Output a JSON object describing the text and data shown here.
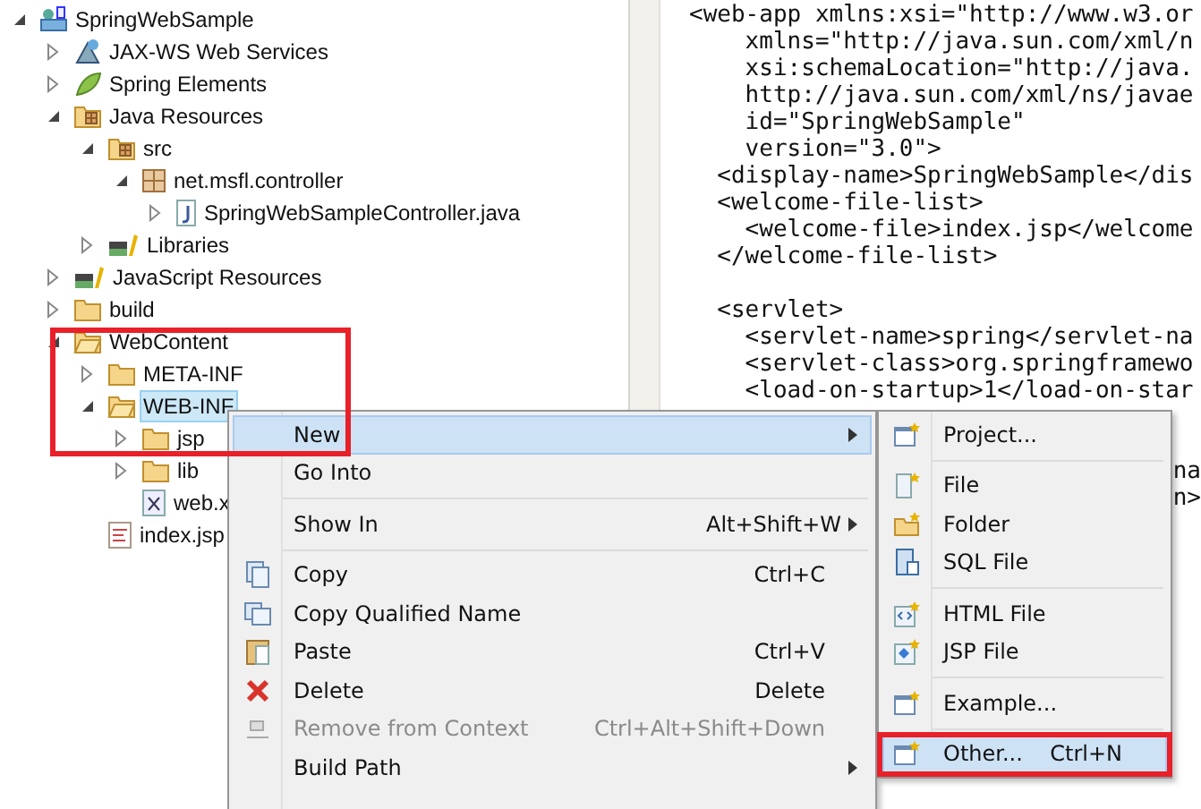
{
  "project_tree": [
    {
      "label": "SpringWebSample",
      "kind": "project",
      "expanded": true,
      "selected": false,
      "children": [
        {
          "label": "JAX-WS Web Services",
          "kind": "webservice",
          "expanded": false,
          "selected": false
        },
        {
          "label": "Spring Elements",
          "kind": "leaf",
          "expanded": false,
          "selected": false
        },
        {
          "label": "Java Resources",
          "kind": "javares",
          "expanded": true,
          "selected": false,
          "children": [
            {
              "label": "src",
              "kind": "srcfolder",
              "expanded": true,
              "selected": false,
              "children": [
                {
                  "label": "net.msfl.controller",
                  "kind": "package",
                  "expanded": true,
                  "selected": false,
                  "children": [
                    {
                      "label": "SpringWebSampleController.java",
                      "kind": "java",
                      "expanded": false,
                      "selected": false
                    }
                  ]
                }
              ]
            },
            {
              "label": "Libraries",
              "kind": "library",
              "expanded": false,
              "selected": false
            }
          ]
        },
        {
          "label": "JavaScript Resources",
          "kind": "library",
          "expanded": false,
          "selected": false
        },
        {
          "label": "build",
          "kind": "folder",
          "expanded": false,
          "selected": false
        },
        {
          "label": "WebContent",
          "kind": "folder",
          "expanded": true,
          "selected": false,
          "children": [
            {
              "label": "META-INF",
              "kind": "folder",
              "expanded": false,
              "selected": false
            },
            {
              "label": "WEB-INF",
              "kind": "folder",
              "expanded": true,
              "selected": true,
              "children": [
                {
                  "label": "jsp",
                  "kind": "folder",
                  "expanded": false,
                  "selected": false
                },
                {
                  "label": "lib",
                  "kind": "folder",
                  "expanded": false,
                  "selected": false
                },
                {
                  "label": "web.x",
                  "kind": "xml",
                  "selected": false
                }
              ]
            },
            {
              "label": "index.jsp",
              "kind": "jsp",
              "selected": false
            }
          ]
        }
      ]
    }
  ],
  "editor_lines": [
    {
      "kind": "code",
      "text": "<web-app xmlns:xsi=\"http://www.w3.or"
    },
    {
      "kind": "code",
      "text": "    xmlns=\"http://java.sun.com/xml/n"
    },
    {
      "kind": "code",
      "text": "    xsi:schemaLocation=\"http://java."
    },
    {
      "kind": "code",
      "text": "    http://java.sun.com/xml/ns/javae"
    },
    {
      "kind": "code",
      "text": "    id=\"SpringWebSample\""
    },
    {
      "kind": "code",
      "text": "    version=\"3.0\">"
    },
    {
      "kind": "code",
      "text": "  <display-name>SpringWebSample</dis"
    },
    {
      "kind": "code",
      "text": "  <welcome-file-list>"
    },
    {
      "kind": "code",
      "text": "    <welcome-file>index.jsp</welcome"
    },
    {
      "kind": "code",
      "text": "  </welcome-file-list>"
    },
    {
      "kind": "blank"
    },
    {
      "kind": "code",
      "text": "  <servlet>"
    },
    {
      "kind": "code",
      "text": "    <servlet-name>spring</servlet-na"
    },
    {
      "kind": "code",
      "text": "    <servlet-class>org.springframewo"
    },
    {
      "kind": "code",
      "text": "    <load-on-startup>1</load-on-star"
    },
    {
      "kind": "hidden"
    },
    {
      "kind": "hidden"
    },
    {
      "kind": "fragment",
      "text": "na"
    },
    {
      "kind": "fragment",
      "text": "n>"
    }
  ],
  "context_menu": [
    {
      "kind": "plain",
      "label": "New",
      "has_submenu": true,
      "selected": true,
      "disabled": false
    },
    {
      "kind": "plain",
      "label": "Go Into",
      "has_submenu": false,
      "selected": false,
      "disabled": false
    },
    {
      "kind": "separator"
    },
    {
      "kind": "plain",
      "label": "Show In",
      "shortcut": "Alt+Shift+W",
      "has_submenu": true,
      "selected": false,
      "disabled": false
    },
    {
      "kind": "separator"
    },
    {
      "kind": "copy",
      "label": "Copy",
      "shortcut": "Ctrl+C",
      "has_submenu": false,
      "selected": false,
      "disabled": false
    },
    {
      "kind": "copyname",
      "label": "Copy Qualified Name",
      "has_submenu": false,
      "selected": false,
      "disabled": false
    },
    {
      "kind": "paste",
      "label": "Paste",
      "shortcut": "Ctrl+V",
      "has_submenu": false,
      "selected": false,
      "disabled": false
    },
    {
      "kind": "delete",
      "label": "Delete",
      "shortcut": "Delete",
      "has_submenu": false,
      "selected": false,
      "disabled": false
    },
    {
      "kind": "remove",
      "label": "Remove from Context",
      "shortcut": "Ctrl+Alt+Shift+Down",
      "has_submenu": false,
      "selected": false,
      "disabled": true
    },
    {
      "kind": "plain",
      "label": "Build Path",
      "has_submenu": true,
      "selected": false,
      "disabled": false
    }
  ],
  "new_submenu": [
    {
      "kind": "project",
      "label": "Project...",
      "selected": false,
      "highlighted": false
    },
    {
      "kind": "separator"
    },
    {
      "kind": "file",
      "label": "File",
      "selected": false,
      "highlighted": false
    },
    {
      "kind": "folder",
      "label": "Folder",
      "selected": false,
      "highlighted": false
    },
    {
      "kind": "sql",
      "label": "SQL File",
      "selected": false,
      "highlighted": false
    },
    {
      "kind": "separator"
    },
    {
      "kind": "html",
      "label": "HTML File",
      "selected": false,
      "highlighted": false
    },
    {
      "kind": "jsp",
      "label": "JSP File",
      "selected": false,
      "highlighted": false
    },
    {
      "kind": "separator"
    },
    {
      "kind": "project",
      "label": "Example...",
      "selected": false,
      "highlighted": false
    },
    {
      "kind": "separator"
    },
    {
      "kind": "project",
      "label": "Other...",
      "shortcut": "Ctrl+N",
      "selected": true,
      "highlighted": true
    }
  ],
  "annotations": {
    "tree_highlight": true
  }
}
